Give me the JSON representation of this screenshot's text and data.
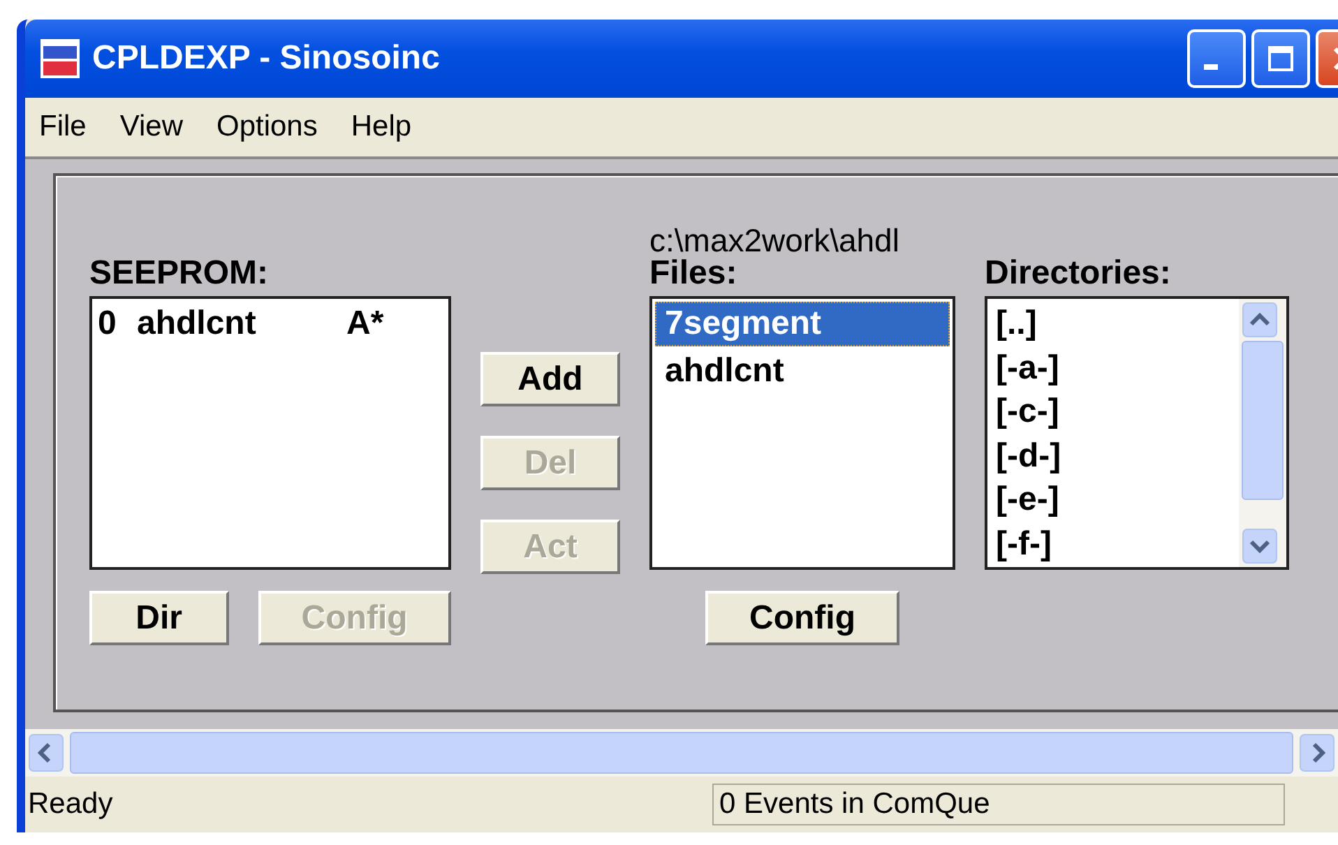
{
  "window": {
    "title": "CPLDEXP - Sinosoinc"
  },
  "menu": [
    "File",
    "View",
    "Options",
    "Help"
  ],
  "seeprom": {
    "label": "SEEPROM:",
    "items": [
      {
        "index": "0",
        "name": "ahdlcnt",
        "flag": "A*"
      }
    ],
    "buttons": [
      {
        "label": "Dir",
        "disabled": false
      },
      {
        "label": "Config",
        "disabled": true
      }
    ]
  },
  "actions": [
    {
      "label": "Add",
      "disabled": false
    },
    {
      "label": "Del",
      "disabled": true
    },
    {
      "label": "Act",
      "disabled": true
    }
  ],
  "files": {
    "path": "c:\\max2work\\ahdl",
    "label": "Files:",
    "items": [
      {
        "name": "7segment",
        "selected": true
      },
      {
        "name": "ahdlcnt",
        "selected": false
      }
    ],
    "button": {
      "label": "Config",
      "disabled": false
    }
  },
  "directories": {
    "label": "Directories:",
    "items": [
      "[..]",
      "[-a-]",
      "[-c-]",
      "[-d-]",
      "[-e-]",
      "[-f-]"
    ]
  },
  "status_bar": [
    "Ready",
    "0 Events in ComQue"
  ]
}
